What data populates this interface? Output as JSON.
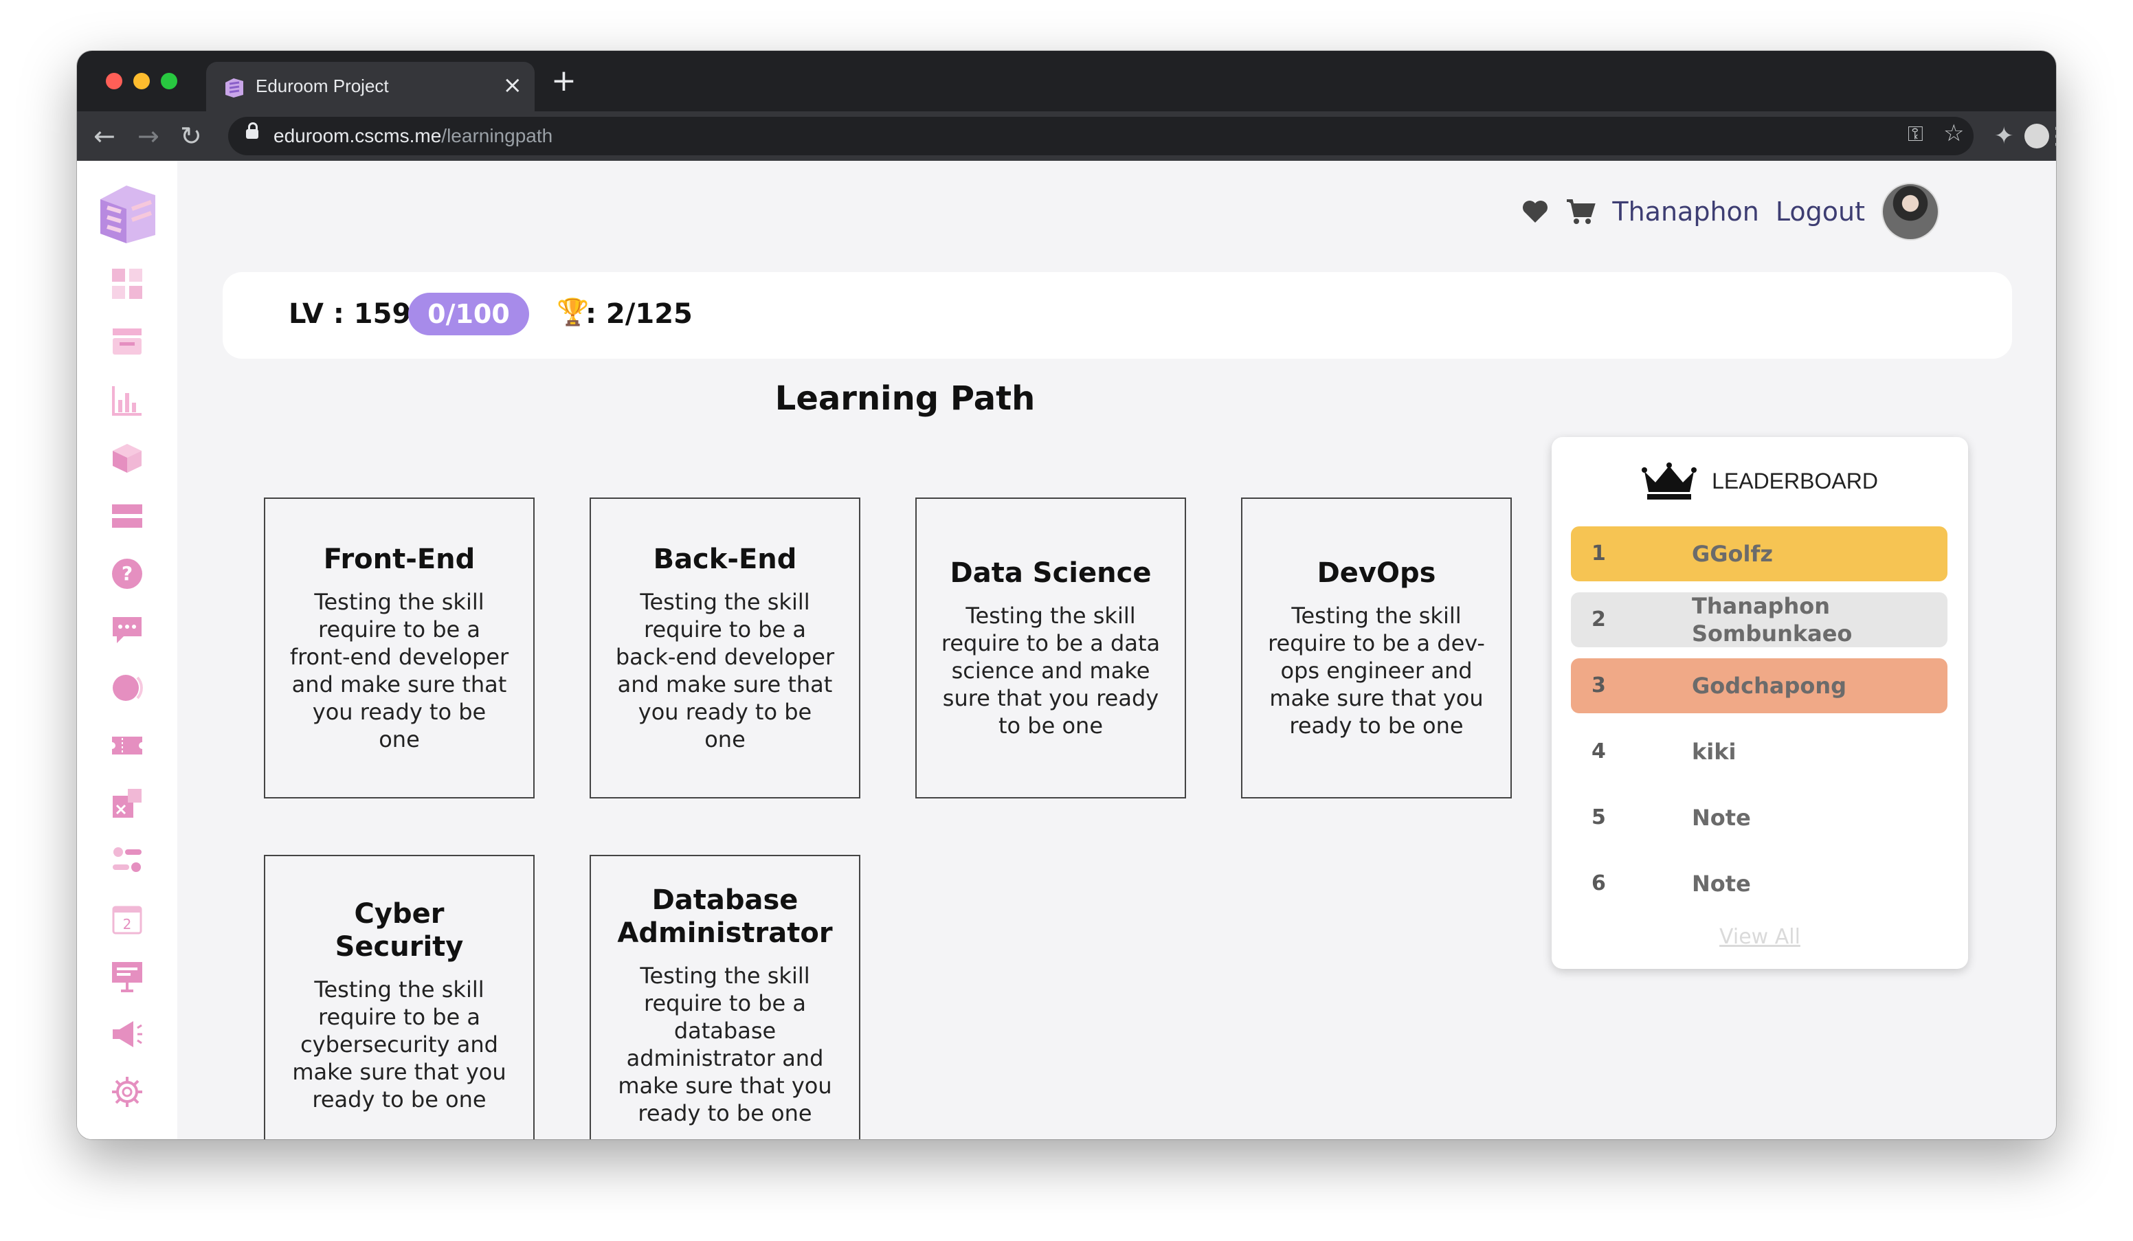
{
  "browser": {
    "tab_title": "Eduroom Project",
    "url_host": "eduroom.cscms.me",
    "url_path": "/learningpath",
    "traffic_colors": [
      "#ff5f57",
      "#febc2e",
      "#28c840"
    ]
  },
  "header": {
    "username": "Thanaphon",
    "logout_label": "Logout"
  },
  "stats": {
    "level": "LV : 159",
    "xp": "0/100",
    "trophies": ": 2/125"
  },
  "learning_path": {
    "title": "Learning Path",
    "cards": [
      {
        "title": "Front-End",
        "desc": "Testing the skill require to be a front-end developer and make sure that you ready to be one"
      },
      {
        "title": "Back-End",
        "desc": "Testing the skill require to be a back-end developer and make sure that you ready to be one"
      },
      {
        "title": "Data Science",
        "desc": "Testing the skill require to be a data science and make sure that you ready to be one"
      },
      {
        "title": "DevOps",
        "desc": "Testing the skill require to be a dev-ops engineer and make sure that you ready to be one"
      },
      {
        "title": "Cyber Security",
        "desc": "Testing the skill require to be a cybersecurity and make sure that you ready to be one"
      },
      {
        "title": "Database Administrator",
        "desc": "Testing the skill require to be a database administrator and make sure that you ready to be one"
      }
    ]
  },
  "leaderboard": {
    "title": "LEADERBOARD",
    "entries": [
      {
        "rank": "1",
        "name": "GGolfz",
        "color": "#f6c453"
      },
      {
        "rank": "2",
        "name": "Thanaphon Sombunkaeo",
        "color": "#e6e6e6"
      },
      {
        "rank": "3",
        "name": "Godchapong",
        "color": "#f0a987"
      },
      {
        "rank": "4",
        "name": "kiki",
        "color": "#ffffff"
      },
      {
        "rank": "5",
        "name": "Note",
        "color": "#ffffff"
      },
      {
        "rank": "6",
        "name": "Note",
        "color": "#ffffff"
      }
    ],
    "view_all": "View All"
  },
  "sidebar": {
    "accent": "#e58fc0",
    "icons": [
      "dashboard-icon",
      "inbox-icon",
      "chart-icon",
      "cube-icon",
      "list-icon",
      "help-icon",
      "chat-icon",
      "pie-icon",
      "ticket-icon",
      "puzzle-icon",
      "toggle-icon",
      "calendar-icon",
      "presentation-icon",
      "megaphone-icon",
      "gear-icon"
    ]
  }
}
